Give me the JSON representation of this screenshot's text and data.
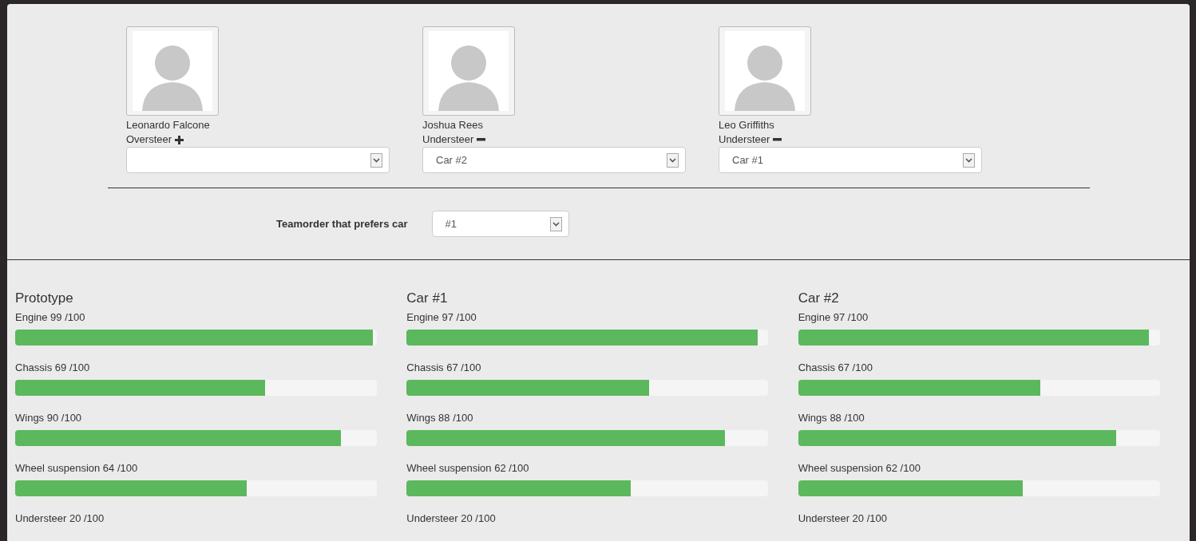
{
  "drivers": [
    {
      "name": "Leonardo Falcone",
      "steering": "Oversteer",
      "kind": "plus"
    },
    {
      "name": "Joshua Rees",
      "steering": "Understeer",
      "kind": "minus",
      "car": "Car #2"
    },
    {
      "name": "Leo Griffiths",
      "steering": "Understeer",
      "kind": "minus",
      "car": "Car #1"
    }
  ],
  "teamorder": {
    "label": "Teamorder that prefers car",
    "value": "#1"
  },
  "cars": [
    {
      "title": "Prototype",
      "stats": [
        {
          "label": "Engine 99 /100",
          "level": 0.99
        },
        {
          "label": "Chassis 69 /100",
          "level": 0.69
        },
        {
          "label": "Wings 90 /100",
          "level": 0.9
        },
        {
          "label": "Wheel suspension 64 /100",
          "level": 0.64
        },
        {
          "label": "Understeer 20 /100"
        }
      ]
    },
    {
      "title": "Car #1",
      "stats": [
        {
          "label": "Engine 97 /100",
          "level": 0.97
        },
        {
          "label": "Chassis 67 /100",
          "level": 0.67
        },
        {
          "label": "Wings 88 /100",
          "level": 0.88
        },
        {
          "label": "Wheel suspension 62 /100",
          "level": 0.62
        },
        {
          "label": "Understeer 20 /100"
        }
      ]
    },
    {
      "title": "Car #2",
      "stats": [
        {
          "label": "Engine 97 /100",
          "level": 0.97
        },
        {
          "label": "Chassis 67 /100",
          "level": 0.67
        },
        {
          "label": "Wings 88 /100",
          "level": 0.88
        },
        {
          "label": "Wheel suspension 62 /100",
          "level": 0.62
        },
        {
          "label": "Understeer 20 /100"
        }
      ]
    }
  ]
}
